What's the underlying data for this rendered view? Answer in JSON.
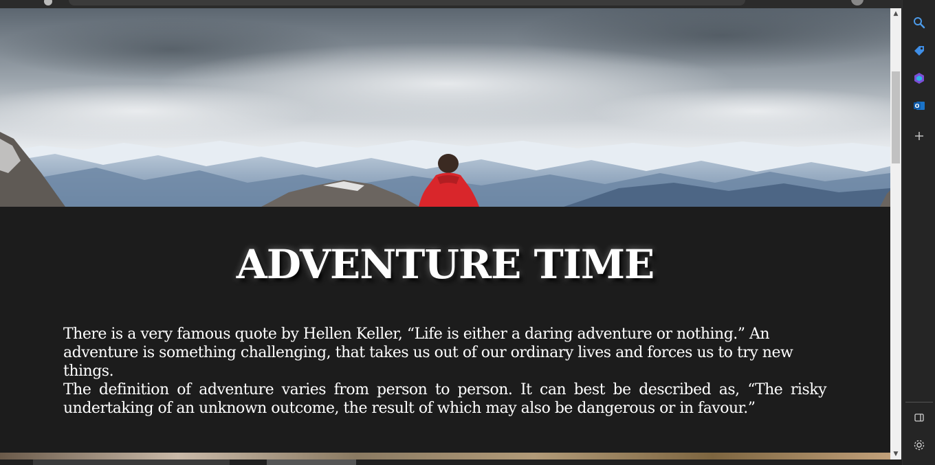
{
  "content": {
    "title": "ADVENTURE TIME",
    "paragraphs": [
      "There is a very famous quote by Hellen Keller, “Life is either a daring adventure or nothing.” An adventure is something challenging, that takes us out of our ordinary lives and forces us to try new things.",
      "The definition of adventure varies from person to person. It can best be described as, “The risky undertaking of an unknown outcome, the result of which may also be dangerous or in favour.”"
    ]
  },
  "hero_image": {
    "subject": "person in red jacket overlooking snowy mountains",
    "jacket_color": "#d9262b"
  },
  "colors": {
    "page_bg": "#1c1c1c",
    "text": "#ffffff",
    "sidebar_bg": "#252525"
  },
  "sidebar": {
    "icons": [
      "search-icon",
      "tag-icon",
      "copilot-icon",
      "outlook-icon",
      "add-icon"
    ],
    "bottom_icons": [
      "sidebar-panel-icon",
      "settings-icon"
    ]
  },
  "scrollbar": {
    "position_fraction": 0.12
  }
}
